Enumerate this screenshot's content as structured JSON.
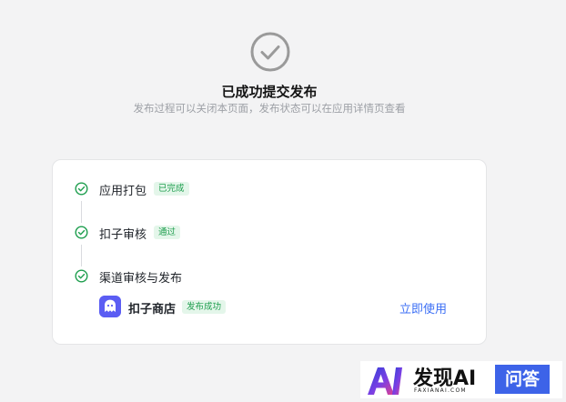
{
  "header": {
    "title": "已成功提交发布",
    "subtitle": "发布过程可以关闭本页面，发布状态可以在应用详情页查看"
  },
  "steps": [
    {
      "label": "应用打包",
      "badge": "已完成"
    },
    {
      "label": "扣子审核",
      "badge": "通过"
    },
    {
      "label": "渠道审核与发布"
    }
  ],
  "channel": {
    "name": "扣子商店",
    "status": "发布成功",
    "action": "立即使用"
  },
  "watermark": {
    "brand": "发现AI",
    "sub": "FAXIANAI.COM",
    "ask": "问答"
  },
  "colors": {
    "success_green": "#1e9e4e",
    "link_blue": "#3c6ff5",
    "store_purple": "#5b5df3",
    "icon_gray": "#9a9a9a"
  }
}
